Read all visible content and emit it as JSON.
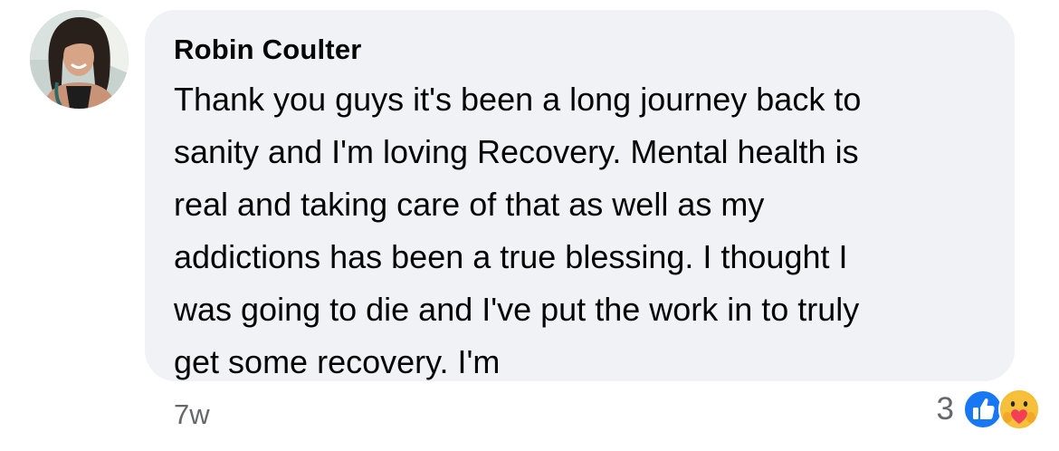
{
  "comment": {
    "author": "Robin Coulter",
    "text": "Thank you guys it's been a long journey back to\nsanity and I'm loving Recovery. Mental health is\nreal and taking care of that as well as my\naddictions has been a true blessing. I thought I\nwas going to die and I've put the work in to truly\nget some recovery. I'm",
    "timestamp": "7w",
    "reaction_count": "3",
    "reactions": [
      "like-icon",
      "care-icon"
    ]
  },
  "colors": {
    "bubble_bg": "#f0f2f5",
    "text": "#050505",
    "secondary_text": "#65676b",
    "like_blue": "#1877f2",
    "care_yellow": "#f7b928"
  }
}
